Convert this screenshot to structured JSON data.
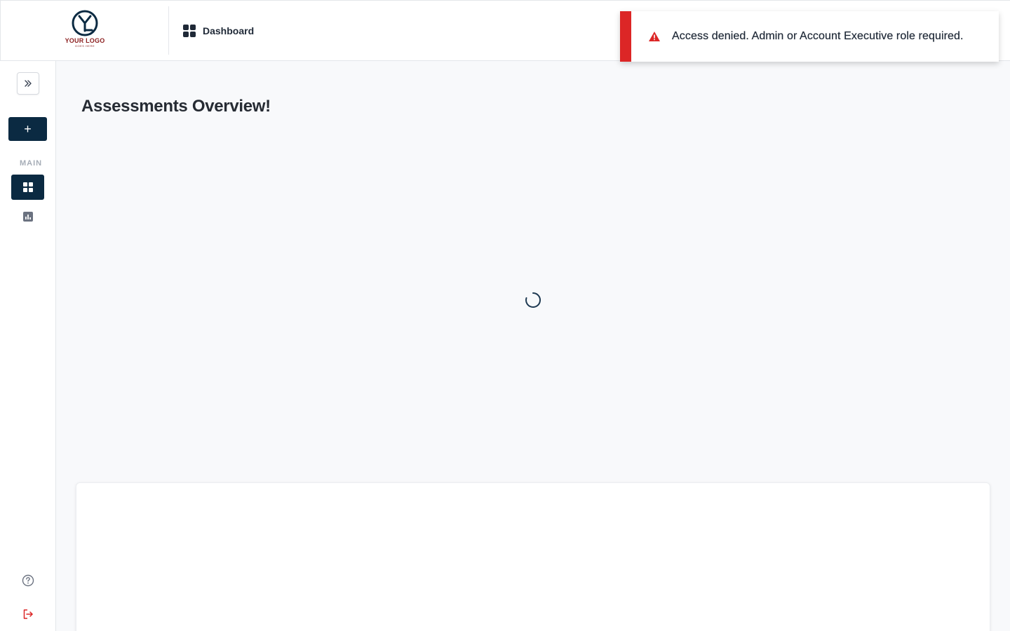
{
  "brand": {
    "logo_text": "YOUR LOGO",
    "logo_subtext": "GOES HERE"
  },
  "header": {
    "breadcrumb_icon": "dashboard-grid-icon",
    "breadcrumb_label": "Dashboard"
  },
  "toast": {
    "type": "error",
    "icon": "warning-triangle-icon",
    "message": "Access denied. Admin or Account Executive role required.",
    "accent_color": "#dc2626"
  },
  "sidebar": {
    "expand_icon": "chevrons-right-icon",
    "add_button_label": "+",
    "section_label": "MAIN",
    "items": [
      {
        "name": "dashboard",
        "icon": "dashboard-grid-icon",
        "active": true
      },
      {
        "name": "reports",
        "icon": "bar-chart-icon",
        "active": false
      }
    ],
    "footer": [
      {
        "name": "help",
        "icon": "help-circle-icon"
      },
      {
        "name": "logout",
        "icon": "logout-icon"
      }
    ],
    "accent_color": "#0b2a42"
  },
  "main": {
    "title": "Assessments Overview!",
    "loading": true
  }
}
